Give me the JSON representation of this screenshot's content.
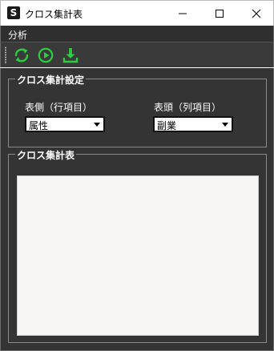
{
  "window": {
    "title": "クロス集計表",
    "app_icon_letter": "S"
  },
  "menu": {
    "items": [
      "分析"
    ]
  },
  "toolbar": {
    "buttons": [
      {
        "icon": "refresh-icon",
        "color": "#2ecc40"
      },
      {
        "icon": "play-icon",
        "color": "#2ecc40"
      },
      {
        "icon": "download-icon",
        "color": "#2ecc40"
      }
    ]
  },
  "settings": {
    "title": "クロス集計設定",
    "row_label": "表側（行項目）",
    "row_value": "属性",
    "col_label": "表頭（列項目）",
    "col_value": "副業"
  },
  "result": {
    "title": "クロス集計表"
  },
  "colors": {
    "panel_bg": "#343434",
    "toolbar_bg": "#3a3a3a",
    "accent_green": "#2ecc40",
    "table_bg": "#f7f6f4"
  }
}
